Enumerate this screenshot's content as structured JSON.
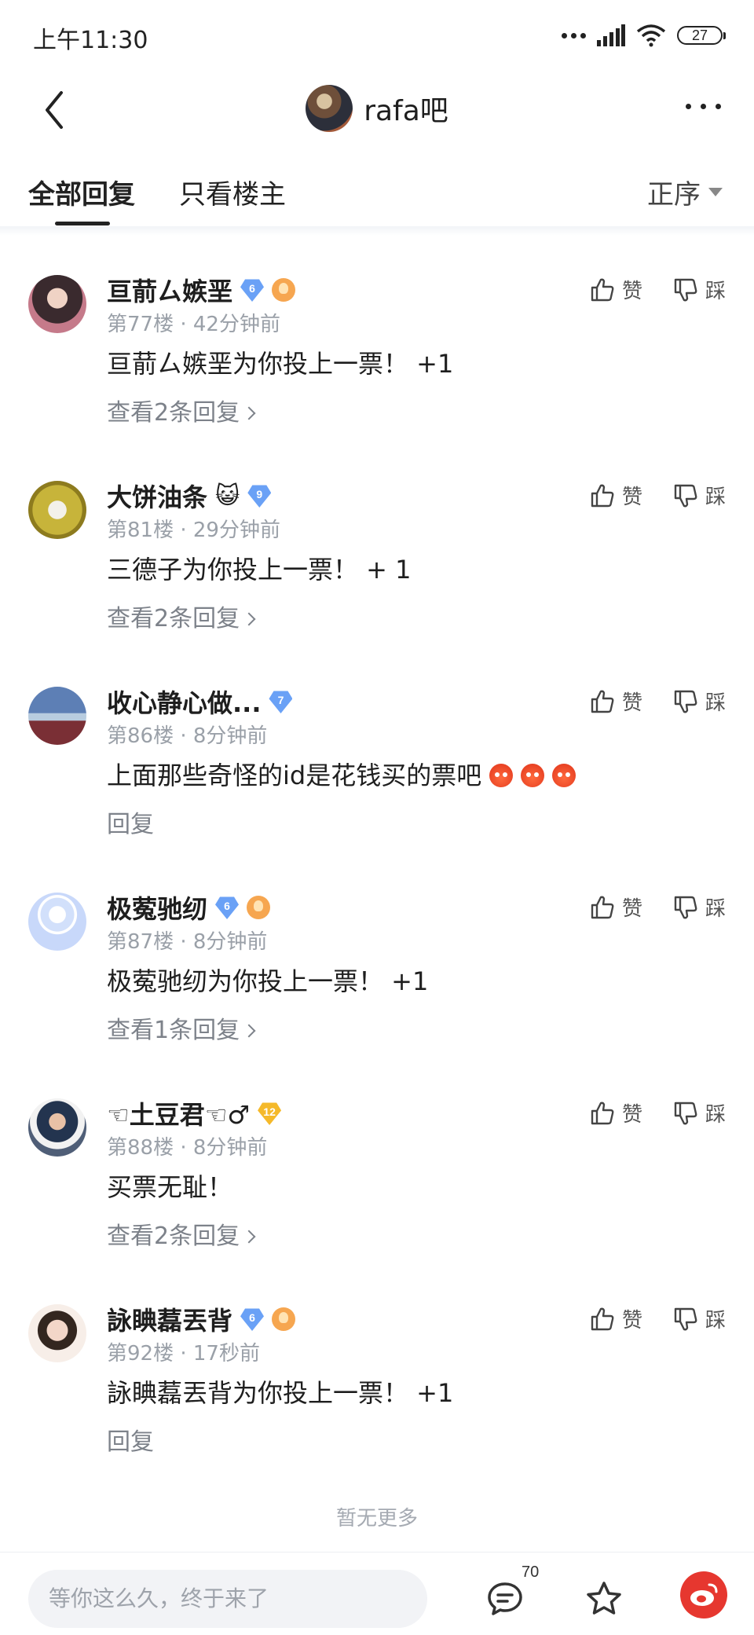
{
  "status_bar": {
    "time": "上午11:30",
    "battery": "27"
  },
  "nav": {
    "title": "rafa吧"
  },
  "tabs": {
    "all": "全部回复",
    "op_only": "只看楼主",
    "order": "正序"
  },
  "actions": {
    "like": "赞",
    "dislike": "踩"
  },
  "replies": [
    {
      "name": "亘葥ㄙ嫉垩",
      "level": "6",
      "level_color": "#6aa1f6",
      "medal": true,
      "cat": "",
      "floor": "第77楼",
      "time": "42分钟前",
      "body": "亘葥ㄙ嫉垩为你投上一票！ +1",
      "sub": "查看2条回复",
      "sub_arrow": true,
      "avatar": "a1",
      "faces": 0
    },
    {
      "name": "大饼油条",
      "level": "9",
      "level_color": "#6aa1f6",
      "medal": false,
      "cat": "😺",
      "floor": "第81楼",
      "time": "29分钟前",
      "body": "三德子为你投上一票！ + 1",
      "sub": "查看2条回复",
      "sub_arrow": true,
      "avatar": "a2",
      "faces": 0
    },
    {
      "name": "收心静心做...",
      "level": "7",
      "level_color": "#6aa1f6",
      "medal": false,
      "cat": "",
      "floor": "第86楼",
      "time": "8分钟前",
      "body": "上面那些奇怪的id是花钱买的票吧",
      "sub": "回复",
      "sub_arrow": false,
      "avatar": "a3",
      "faces": 3
    },
    {
      "name": "极蒬驰纫",
      "level": "6",
      "level_color": "#6aa1f6",
      "medal": true,
      "cat": "",
      "floor": "第87楼",
      "time": "8分钟前",
      "body": "极蒬驰纫为你投上一票！ +1",
      "sub": "查看1条回复",
      "sub_arrow": true,
      "avatar": "a4",
      "faces": 0
    },
    {
      "name": "☜土豆君☜♂",
      "level": "12",
      "level_color": "#f5b92a",
      "medal": false,
      "cat": "",
      "floor": "第88楼",
      "time": "8分钟前",
      "body": "买票无耻！",
      "sub": "查看2条回复",
      "sub_arrow": true,
      "avatar": "a5",
      "faces": 0
    },
    {
      "name": "詠睓藞丟背",
      "level": "6",
      "level_color": "#6aa1f6",
      "medal": true,
      "cat": "",
      "floor": "第92楼",
      "time": "17秒前",
      "body": "詠睓藞丟背为你投上一票！ +1",
      "sub": "回复",
      "sub_arrow": false,
      "avatar": "a6",
      "faces": 0
    }
  ],
  "no_more": "暂无更多",
  "bottom": {
    "input_placeholder": "等你这么久，终于来了",
    "comment_count": "70"
  }
}
